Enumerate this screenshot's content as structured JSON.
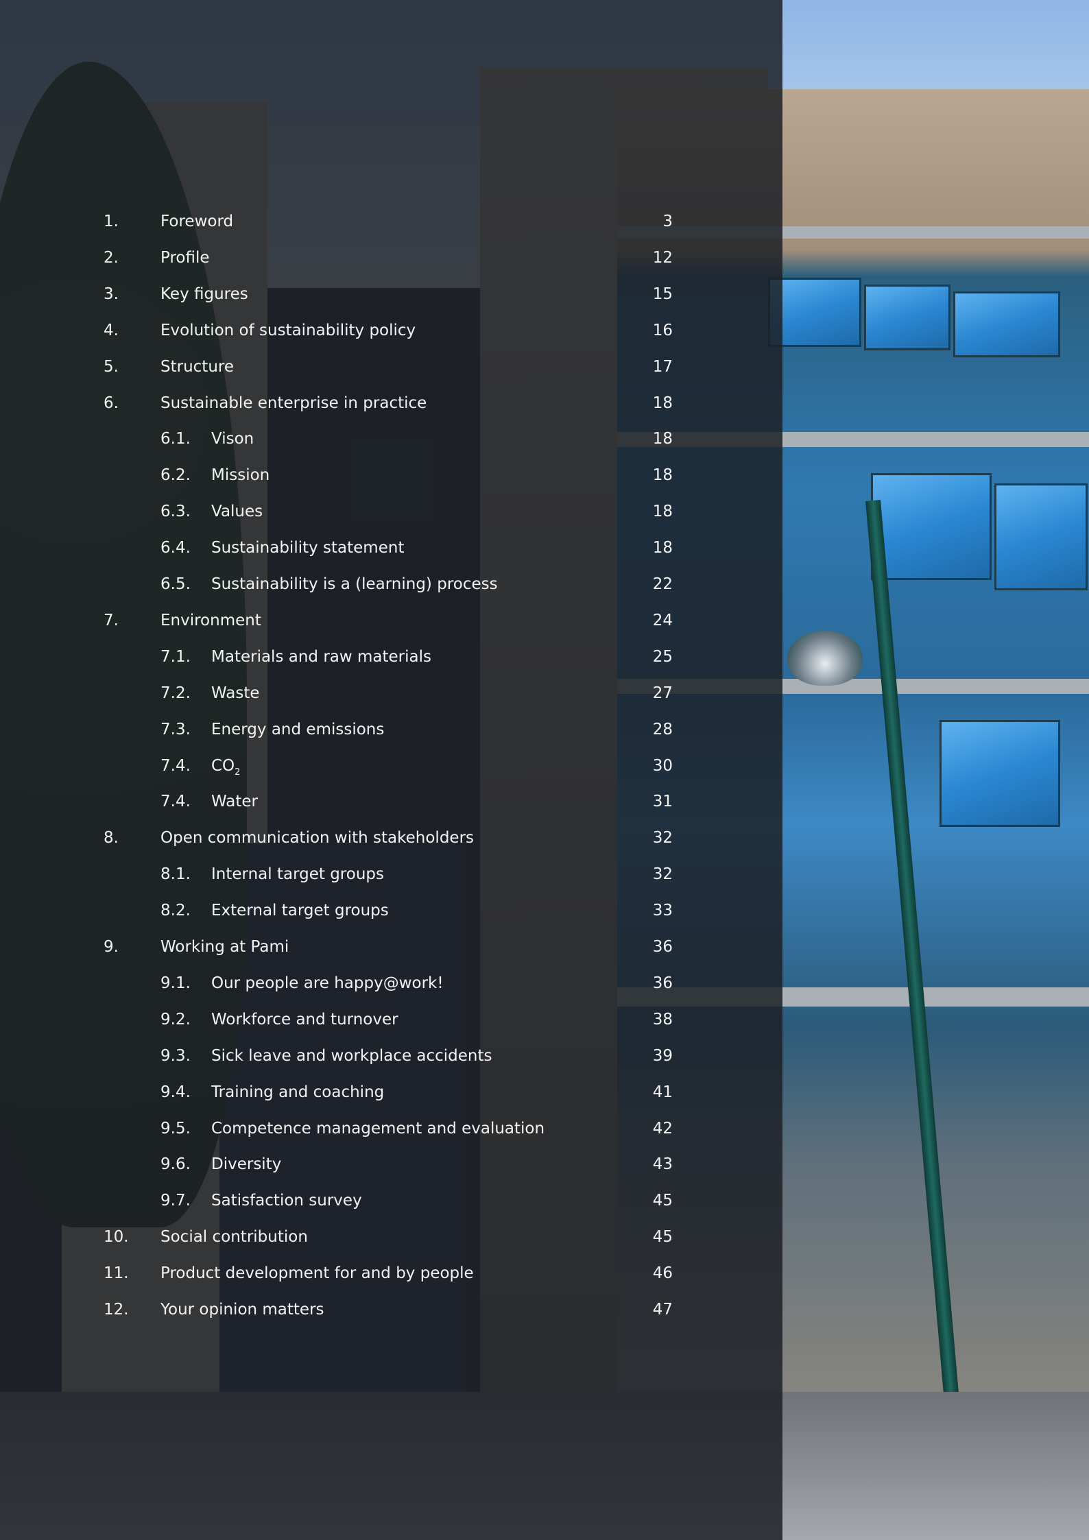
{
  "toc": [
    {
      "num": "1.",
      "title": "Foreword",
      "page": "3"
    },
    {
      "num": "2.",
      "title": "Profile",
      "page": "12"
    },
    {
      "num": "3.",
      "title": "Key figures",
      "page": "15"
    },
    {
      "num": "4.",
      "title": "Evolution of sustainability policy",
      "page": "16"
    },
    {
      "num": "5.",
      "title": "Structure",
      "page": "17"
    },
    {
      "num": "6.",
      "title": "Sustainable enterprise in practice",
      "page": "18"
    },
    {
      "num": "6.1.",
      "title": "Vison",
      "page": "18",
      "sub": true
    },
    {
      "num": "6.2.",
      "title": "Mission",
      "page": "18",
      "sub": true
    },
    {
      "num": "6.3.",
      "title": "Values",
      "page": "18",
      "sub": true
    },
    {
      "num": "6.4.",
      "title": "Sustainability statement",
      "page": "18",
      "sub": true
    },
    {
      "num": "6.5.",
      "title": "Sustainability is a (learning) process",
      "page": "22",
      "sub": true
    },
    {
      "num": "7.",
      "title": "Environment",
      "page": "24"
    },
    {
      "num": "7.1.",
      "title": "Materials and raw materials",
      "page": "25",
      "sub": true
    },
    {
      "num": "7.2.",
      "title": "Waste",
      "page": "27",
      "sub": true
    },
    {
      "num": "7.3.",
      "title": "Energy and emissions",
      "page": "28",
      "sub": true
    },
    {
      "num": "7.4.",
      "title": "CO",
      "title_sub": "2",
      "page": "30",
      "sub": true
    },
    {
      "num": "7.4.",
      "title": "Water",
      "page": "31",
      "sub": true
    },
    {
      "num": "8.",
      "title": "Open communication with stakeholders",
      "page": "32"
    },
    {
      "num": "8.1.",
      "title": "Internal target groups",
      "page": "32",
      "sub": true
    },
    {
      "num": "8.2.",
      "title": "External target groups",
      "page": "33",
      "sub": true
    },
    {
      "num": "9.",
      "title": "Working at Pami",
      "page": "36"
    },
    {
      "num": "9.1.",
      "title": "Our people are happy@work!",
      "page": "36",
      "sub": true
    },
    {
      "num": "9.2.",
      "title": "Workforce and turnover",
      "page": "38",
      "sub": true
    },
    {
      "num": "9.3.",
      "title": "Sick leave and workplace accidents",
      "page": "39",
      "sub": true
    },
    {
      "num": "9.4.",
      "title": "Training and coaching",
      "page": "41",
      "sub": true
    },
    {
      "num": "9.5.",
      "title": "Competence management and evaluation",
      "page": "42",
      "sub": true
    },
    {
      "num": "9.6.",
      "title": "Diversity",
      "page": "43",
      "sub": true
    },
    {
      "num": "9.7.",
      "title": "Satisfaction survey",
      "page": "45",
      "sub": true
    },
    {
      "num": "10.",
      "title": "Social contribution",
      "page": "45"
    },
    {
      "num": "11.",
      "title": "Product development for and by people",
      "page": "46"
    },
    {
      "num": "12.",
      "title": "Your opinion matters",
      "page": "47"
    }
  ]
}
